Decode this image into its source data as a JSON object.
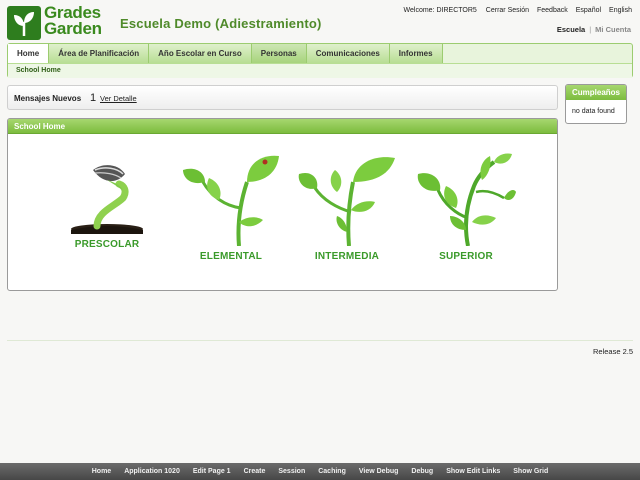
{
  "header": {
    "logo_line1": "Grades",
    "logo_line2": "Garden",
    "school_title": "Escuela Demo (Adiestramiento)"
  },
  "top_links": {
    "welcome": "Welcome: DIRECTOR5",
    "logout": "Cerrar Sesión",
    "feedback": "Feedback",
    "spanish": "Español",
    "english": "English"
  },
  "view_switch": {
    "school": "Escuela",
    "separator": "|",
    "account": "Mi Cuenta"
  },
  "nav": {
    "tabs": [
      {
        "label": "Home"
      },
      {
        "label": "Área de Planificación"
      },
      {
        "label": "Año Escolar en Curso"
      },
      {
        "label": "Personas"
      },
      {
        "label": "Comunicaciones"
      },
      {
        "label": "Informes"
      }
    ],
    "subnav_item": "School Home"
  },
  "messages": {
    "label": "Mensajes Nuevos",
    "count": "1",
    "link": "Ver Detalle"
  },
  "region": {
    "title": "School Home",
    "levels": [
      {
        "label": "PRESCOLAR",
        "icon": "seedling-sprout-icon"
      },
      {
        "label": "ELEMENTAL",
        "icon": "young-plant-icon"
      },
      {
        "label": "INTERMEDIA",
        "icon": "growing-plant-icon"
      },
      {
        "label": "SUPERIOR",
        "icon": "mature-plant-icon"
      }
    ]
  },
  "birthdays": {
    "title": "Cumpleaños",
    "empty": "no data found"
  },
  "footer": {
    "release": "Release 2.5"
  },
  "devbar": {
    "items": [
      "Home",
      "Application 1020",
      "Edit Page 1",
      "Create",
      "Session",
      "Caching",
      "View Debug",
      "Debug",
      "Show Edit Links",
      "Show Grid"
    ]
  },
  "colors": {
    "brand_green": "#3a8a1e",
    "region_header": "#7cbc3e",
    "level_label": "#3a9a2a"
  }
}
